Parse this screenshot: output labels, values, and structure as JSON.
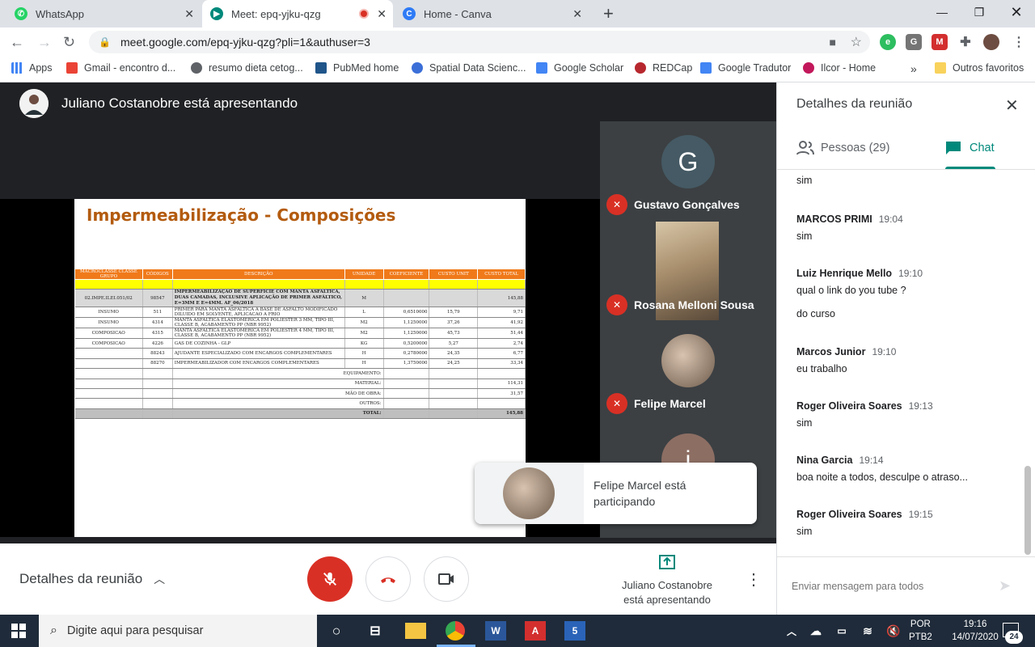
{
  "browser": {
    "tabs": [
      {
        "title": "WhatsApp",
        "icon": "whatsapp-icon",
        "color": "#25d366"
      },
      {
        "title": "Meet: epq-yjku-qzg",
        "icon": "meet-icon",
        "color": "#00897b"
      },
      {
        "title": "Home - Canva",
        "icon": "canva-icon",
        "color": "#2f7bf6"
      }
    ],
    "url": "meet.google.com/epq-yjku-qzg?pli=1&authuser=3",
    "bookmarks": [
      {
        "label": "Apps",
        "color": "#4285f4"
      },
      {
        "label": "Gmail - encontro d...",
        "color": "#ea4335"
      },
      {
        "label": "resumo dieta cetog...",
        "color": "#5f6368"
      },
      {
        "label": "PubMed home",
        "color": "#20558a"
      },
      {
        "label": "Spatial Data Scienc...",
        "color": "#3b6fd8"
      },
      {
        "label": "Google Scholar",
        "color": "#4285f4"
      },
      {
        "label": "REDCap",
        "color": "#b7282e"
      },
      {
        "label": "Google Tradutor",
        "color": "#4285f4"
      },
      {
        "label": "Ilcor - Home",
        "color": "#c2185b"
      }
    ],
    "other_bookmarks": "Outros favoritos",
    "overflow": "»"
  },
  "meet": {
    "presenter_banner": "Juliano Costanobre está apresentando",
    "slide": {
      "title": "Impermeabilização - Composições",
      "headers": [
        "MACROCLASSE CLASSE GRUPO",
        "CÓDIGOS",
        "DESCRIÇÃO",
        "UNIDADE",
        "COEFICIENTE",
        "CUSTO UNIT",
        "CUSTO TOTAL"
      ],
      "main_row": [
        "02.IMPE.ILEI.051/02",
        "98547",
        "IMPERMEABILIZAÇÃO DE SUPERFÍCIE COM MANTA ASFÁLTICA, DUAS CAMADAS, INCLUSIVE APLICAÇÃO DE PRIMER ASFÁLTICO, E=3MM E E=4MM. AF_06/2018",
        "M",
        "",
        "",
        "145,88"
      ],
      "rows": [
        [
          "INSUMO",
          "511",
          "PRIMER PARA MANTA ASFALTICA A BASE DE ASFALTO MODIFICADO DILUIDO EM SOLVENTE, APLICACAO A FRIO",
          "L",
          "0,6510000",
          "15,79",
          "9,71"
        ],
        [
          "INSUMO",
          "4314",
          "MANTA ASFALTICA ELASTOMERICA EM POLIESTER 3 MM, TIPO III, CLASSE B, ACABAMENTO PP (NBR 9952)",
          "M2",
          "1,1250000",
          "37,26",
          "41,92"
        ],
        [
          "COMPOSICAO",
          "4315",
          "MANTA ASFALTICA ELASTOMERICA EM POLIESTER 4 MM, TIPO III, CLASSE B, ACABAMENTO PP (NBR 9952)",
          "M2",
          "1,1250000",
          "45,73",
          "51,44"
        ],
        [
          "COMPOSICAO",
          "4226",
          "GAS DE COZINHA - GLP",
          "KG",
          "0,5200000",
          "5,27",
          "2,74"
        ],
        [
          "",
          "88243",
          "AJUDANTE ESPECIALIZADO COM ENCARGOS COMPLEMENTARES",
          "H",
          "0,2780000",
          "24,35",
          "6,77"
        ],
        [
          "",
          "88270",
          "IMPERMEABILIZADOR COM ENCARGOS COMPLEMENTARES",
          "H",
          "1,3750000",
          "24,25",
          "33,34"
        ]
      ],
      "summary": [
        {
          "label": "EQUIPAMENTO:",
          "value": ""
        },
        {
          "label": "MATERIAL:",
          "value": "114,31"
        },
        {
          "label": "MÃO DE OBRA:",
          "value": "31,57"
        },
        {
          "label": "OUTROS:",
          "value": ""
        },
        {
          "label": "TOTAL:",
          "value": "145,88"
        }
      ]
    },
    "participants": [
      {
        "name": "Gustavo Gonçalves",
        "initial": "G",
        "color": "#455a64"
      },
      {
        "name": "Rosana Melloni Sousa"
      },
      {
        "name": "Felipe Marcel"
      },
      {
        "initial": "j",
        "color": "#8d6e63"
      }
    ],
    "toast": "Felipe Marcel está participando",
    "bottom": {
      "details_label": "Detalhes da reunião",
      "presenting_label": "Juliano Costanobre está apresentando"
    }
  },
  "panel": {
    "title": "Detalhes da reunião",
    "tab_people": "Pessoas (29)",
    "tab_chat": "Chat",
    "first_text": "sim",
    "messages": [
      {
        "author": "MARCOS PRIMI",
        "time": "19:04",
        "lines": [
          "sim"
        ]
      },
      {
        "author": "Luiz Henrique Mello",
        "time": "19:10",
        "lines": [
          "qual o link do you tube ?",
          "do curso"
        ]
      },
      {
        "author": "Marcos Junior",
        "time": "19:10",
        "lines": [
          "eu trabalho"
        ]
      },
      {
        "author": "Roger Oliveira Soares",
        "time": "19:13",
        "lines": [
          "sim"
        ]
      },
      {
        "author": "Nina Garcia",
        "time": "19:14",
        "lines": [
          "boa noite a todos, desculpe o atraso..."
        ]
      },
      {
        "author": "Roger Oliveira Soares",
        "time": "19:15",
        "lines": [
          "sim"
        ]
      }
    ],
    "input_placeholder": "Enviar mensagem para todos"
  },
  "taskbar": {
    "search_placeholder": "Digite aqui para pesquisar",
    "lang": "POR",
    "layout": "PTB2",
    "time": "19:16",
    "date": "14/07/2020",
    "notifications": "24"
  },
  "colors": {
    "meet_red": "#d93025",
    "meet_green": "#00897b",
    "slide_orange": "#f07a1a"
  }
}
